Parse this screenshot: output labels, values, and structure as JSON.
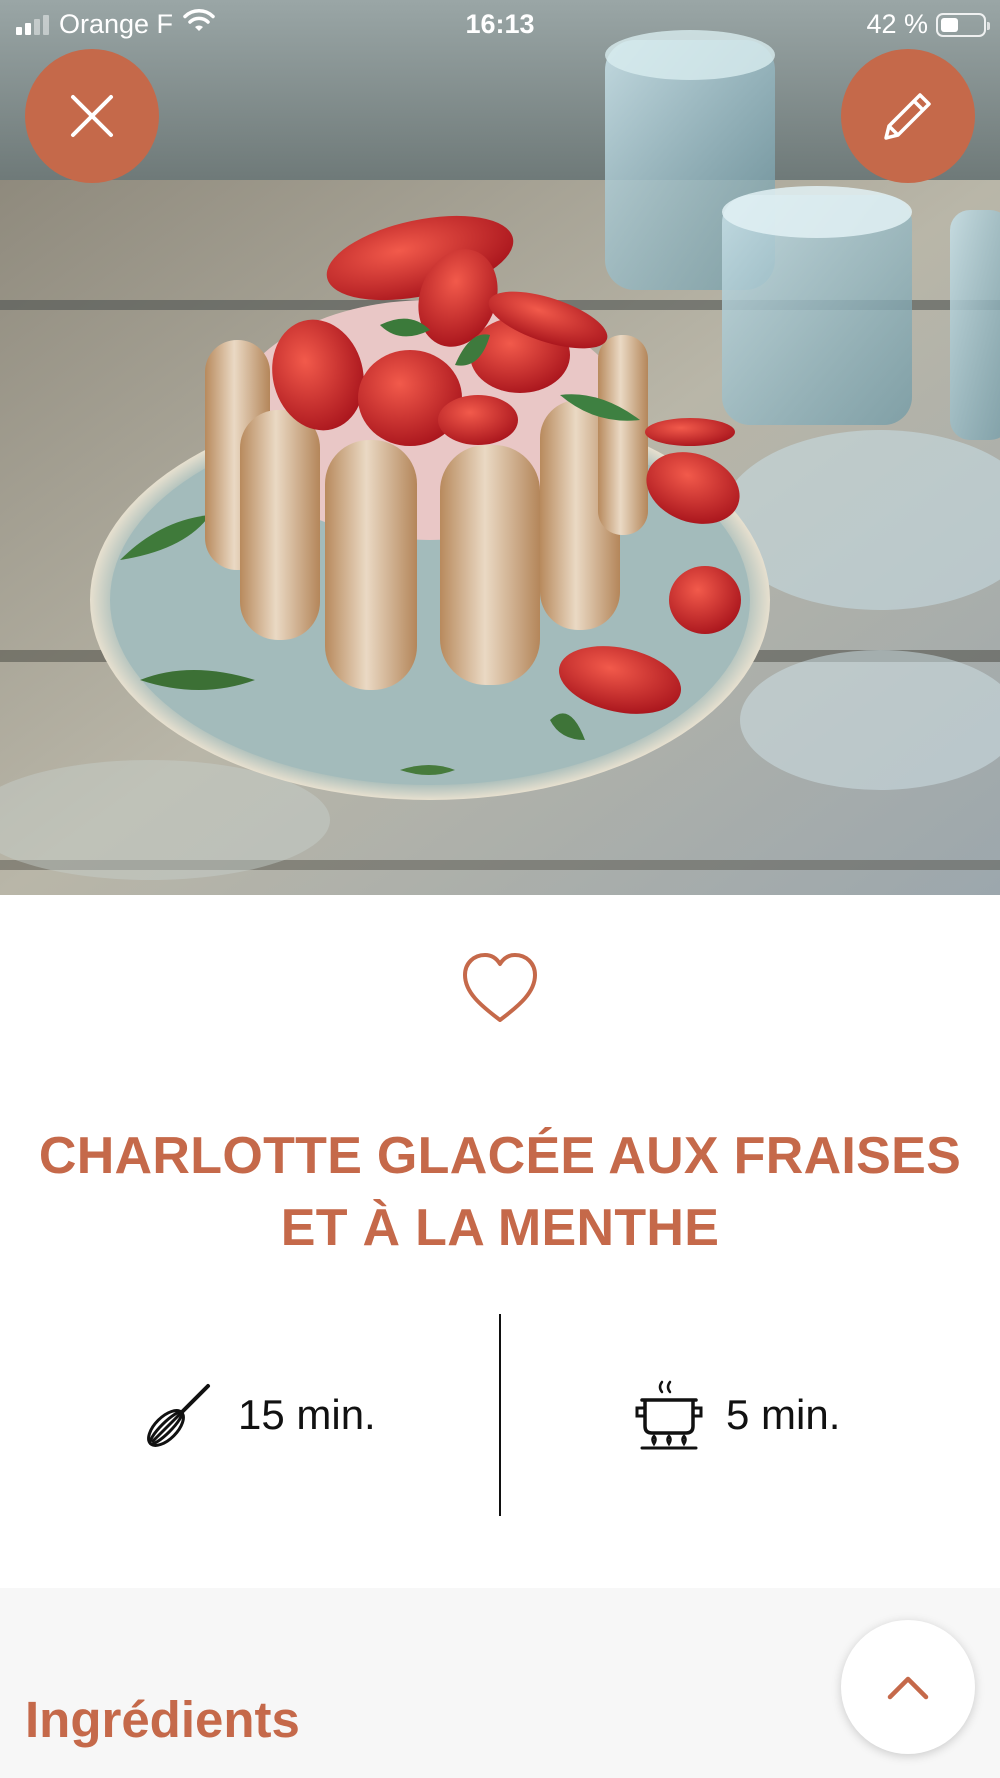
{
  "status_bar": {
    "carrier": "Orange F",
    "time": "16:13",
    "battery_text": "42 %",
    "battery_level": 0.42
  },
  "header": {
    "close_icon": "close-icon",
    "edit_icon": "pencil-icon"
  },
  "hero": {
    "image_subject": "strawberry charlotte cake with ladyfingers and mint on a blue plate"
  },
  "recipe": {
    "favorite_icon": "heart-outline-icon",
    "title": "CHARLOTTE GLACÉE AUX FRAISES ET À LA MENTHE",
    "prep_time": "15 min.",
    "prep_icon": "whisk-icon",
    "cook_time": "5 min.",
    "cook_icon": "cooking-pot-icon"
  },
  "sections": {
    "ingredients_heading": "Ingrédients"
  },
  "scroll_top": {
    "icon": "chevron-up-icon"
  },
  "colors": {
    "accent": "#c5694a",
    "text": "#111111",
    "section_bg": "#f7f7f7"
  }
}
